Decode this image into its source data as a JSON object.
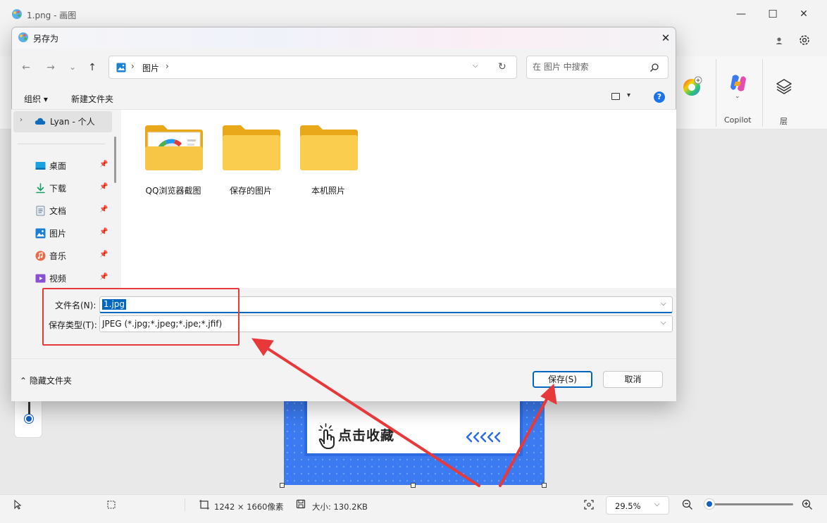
{
  "paint": {
    "title": "1.png - 画图",
    "window_controls": {
      "minimize": "—",
      "maximize": "☐",
      "close": "✕"
    },
    "ribbon": {
      "copilot_label": "Copilot",
      "layers_label": "层"
    },
    "canvas_image_text": "点击收藏",
    "status": {
      "dimensions": "1242 × 1660像素",
      "size": "大小: 130.2KB",
      "zoom": "29.5%"
    }
  },
  "dialog": {
    "title": "另存为",
    "close": "✕",
    "nav": {
      "back": "←",
      "forward": "→",
      "recent": "⌄",
      "up": "↑"
    },
    "address": {
      "sep": "›",
      "folder": "图片"
    },
    "search_placeholder": "在 图片 中搜索",
    "toolbar": {
      "organize": "组织 ▾",
      "new_folder": "新建文件夹",
      "help": "?"
    },
    "nav_pane": {
      "onedrive": "Lyan - 个人",
      "items": [
        {
          "label": "桌面"
        },
        {
          "label": "下载"
        },
        {
          "label": "文档"
        },
        {
          "label": "图片"
        },
        {
          "label": "音乐"
        },
        {
          "label": "视频"
        }
      ]
    },
    "folders": [
      {
        "label": "QQ浏览器截图"
      },
      {
        "label": "保存的图片"
      },
      {
        "label": "本机照片"
      }
    ],
    "filename_label": "文件名(N):",
    "filename_value": "1.jpg",
    "filetype_label": "保存类型(T):",
    "filetype_value": "JPEG (*.jpg;*.jpeg;*.jpe;*.jfif)",
    "hide_folders": "隐藏文件夹",
    "save_button": "保存(S)",
    "cancel_button": "取消"
  },
  "colors": {
    "accent": "#0067c0",
    "annotation": "#e8393a"
  }
}
